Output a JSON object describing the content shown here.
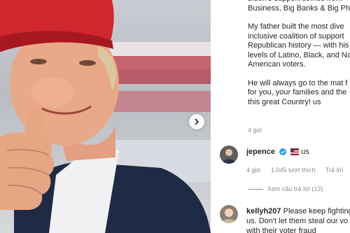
{
  "post": {
    "image_alt_icon": "thumbs-up-photo",
    "caption_paragraphs": [
      "biden's support comes from\nBusiness, Big Banks & Big Pha",
      "My father built the most dive\ninclusive coalition of support\nRepublican history — with his\nlevels of Latino, Black, and Na\nAmerican voters.",
      "He will always go to the mat f\nfor you, your families and the\nthis great Country! us"
    ],
    "caption_time": "4 giờ"
  },
  "comments": [
    {
      "username": "jepence",
      "text": "us",
      "time": "4 giờ",
      "likes": "1.045 lượt thích",
      "reply_label": "Trả lời",
      "view_replies": "Xem câu trả lời (13)"
    },
    {
      "username": "kellyh207",
      "text": "Please keep fighting\nus. Don't let them steal our vo\nwith their voter fraud"
    }
  ],
  "colors": {
    "verified": "#3897f0",
    "muted": "#8e8e8e",
    "hat_red": "#d0262d"
  }
}
